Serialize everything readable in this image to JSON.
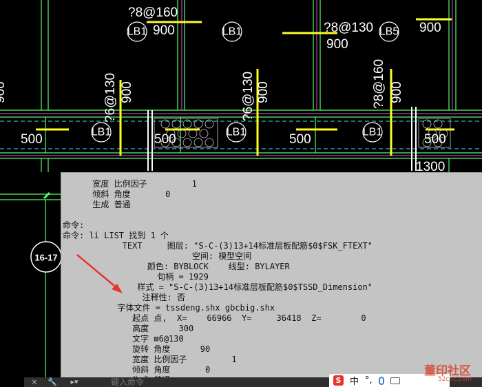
{
  "drawing": {
    "slab_labels": [
      "LB1",
      "LB1",
      "LB5",
      "LB1",
      "LB1",
      "LB1"
    ],
    "axis_bubble": "16-17",
    "rebar_texts": [
      "?8@160",
      "?8@130",
      "?6@130",
      "?6@130",
      "?8@160"
    ],
    "dims": [
      "900",
      "900",
      "900",
      "900",
      "900",
      "900",
      "900",
      "500",
      "500",
      "500",
      "500",
      "1300"
    ]
  },
  "text_window": {
    "lines": [
      "      宽度 比例因子         1",
      "      倾斜 角度       0",
      "      生成 普通",
      "",
      "命令:",
      "命令: li LIST 找到 1 个",
      "            TEXT     图层: \"S-C-(3)13+14标准层板配筋$0$FSK_FTEXT\"",
      "                          空间: 模型空间",
      "                 颜色: BYBLOCK    线型: BYLAYER",
      "                   句柄 = 1929",
      "               样式 = \"S-C-(3)13+14标准层板配筋$0$TSSD_Dimension\"",
      "                注释性: 否",
      "           字体文件 = tssdeng.shx gbcbig.shx",
      "              起点 点,  X=    66966  Y=     36418  Z=        0",
      "              高度      300",
      "              文字 ⊠6@130",
      "              旋转 角度      90",
      "              宽度 比例因子         1",
      "              倾斜 角度       0",
      "              生成 普通"
    ]
  },
  "command_bar": {
    "placeholder": "键入命令",
    "close_icon": "×",
    "settings_icon": "🔧",
    "prompt_icon": "▸▾"
  },
  "ime": {
    "logo": "S",
    "lang": "中",
    "punct": "°,",
    "mic_icon": "mic-icon",
    "mode_icon": "keyboard-icon"
  },
  "watermark": {
    "text": "董印社区",
    "sub": "52cnc.com"
  },
  "colors": {
    "wall_green": "#55ff66",
    "slab_magenta": "#ee44ee",
    "dim_yellow": "#ffff22",
    "cyan": "#44e5e5",
    "arrow_red": "#e8352b",
    "panel_gray": "#c4c4c4"
  }
}
